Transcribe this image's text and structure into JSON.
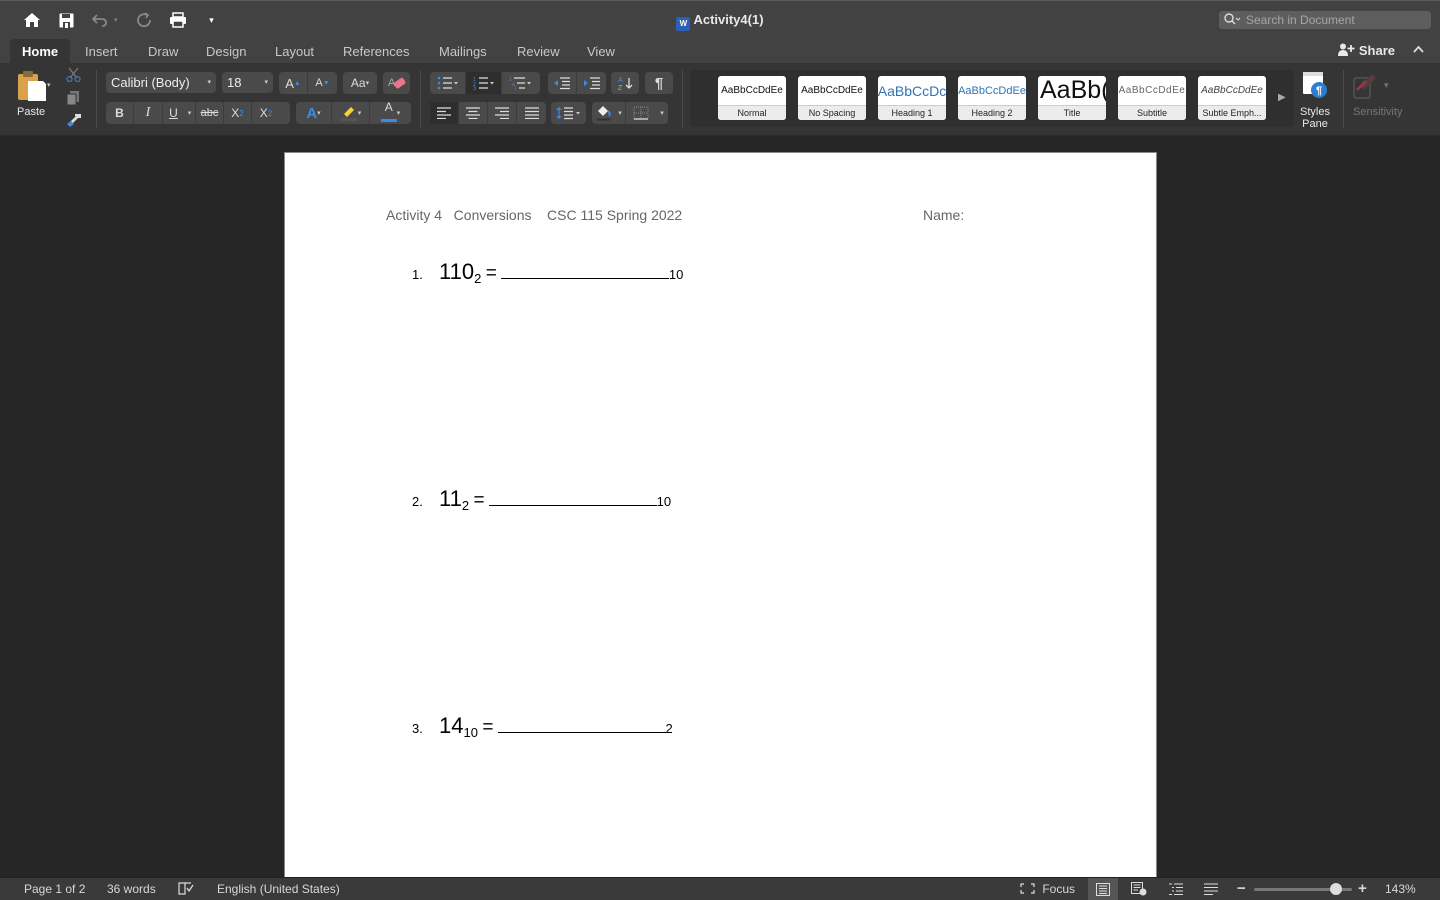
{
  "app": {
    "window_title": "Activity4(1)",
    "search_placeholder": "Search in Document",
    "share_label": "Share"
  },
  "quick_access": [
    {
      "icon": "home-icon"
    },
    {
      "icon": "save-icon"
    },
    {
      "icon": "undo-icon"
    },
    {
      "icon": "redo-icon"
    },
    {
      "icon": "print-icon"
    },
    {
      "icon": "customize-toolbar-icon"
    }
  ],
  "tabs": [
    {
      "label": "Home",
      "active": true
    },
    {
      "label": "Insert"
    },
    {
      "label": "Draw"
    },
    {
      "label": "Design"
    },
    {
      "label": "Layout"
    },
    {
      "label": "References"
    },
    {
      "label": "Mailings"
    },
    {
      "label": "Review"
    },
    {
      "label": "View"
    }
  ],
  "ribbon": {
    "paste_label": "Paste",
    "font_name": "Calibri (Body)",
    "font_size": "18",
    "format_buttons": {
      "bold": "B",
      "italic": "I",
      "underline": "U",
      "strikethrough": "abc",
      "subscript": "X₂",
      "superscript": "X²"
    },
    "styles": [
      {
        "preview": "AaBbCcDdEe",
        "label": "Normal"
      },
      {
        "preview": "AaBbCcDdEe",
        "label": "No Spacing"
      },
      {
        "preview": "AaBbCcDc",
        "label": "Heading 1"
      },
      {
        "preview": "AaBbCcDdEe",
        "label": "Heading 2"
      },
      {
        "preview": "AaBb(",
        "label": "Title"
      },
      {
        "preview": "AaBbCcDdEe",
        "label": "Subtitle"
      },
      {
        "preview": "AaBbCcDdEe",
        "label": "Subtle Emph..."
      }
    ],
    "styles_pane_label_1": "Styles",
    "styles_pane_label_2": "Pane",
    "sensitivity_label": "Sensitivity"
  },
  "document": {
    "header_left": "Activity 4   Conversions    CSC 115 Spring 2022",
    "header_right": "Name:",
    "questions": [
      {
        "number": "1.",
        "value": "110",
        "from_base": "2",
        "equals": "=",
        "to_base": "10"
      },
      {
        "number": "2.",
        "value": "11",
        "from_base": "2",
        "equals": "=",
        "to_base": "10"
      },
      {
        "number": "3.",
        "value": "14",
        "from_base": "10",
        "equals": "=",
        "to_base": "2"
      }
    ]
  },
  "status": {
    "page": "Page 1 of 2",
    "words": "36 words",
    "language": "English (United States)",
    "focus_label": "Focus",
    "zoom": "143%",
    "zoom_level_percent": 143
  },
  "colors": {
    "accent_blue": "#2f7cd3",
    "heading_blue": "#2e74b5"
  }
}
